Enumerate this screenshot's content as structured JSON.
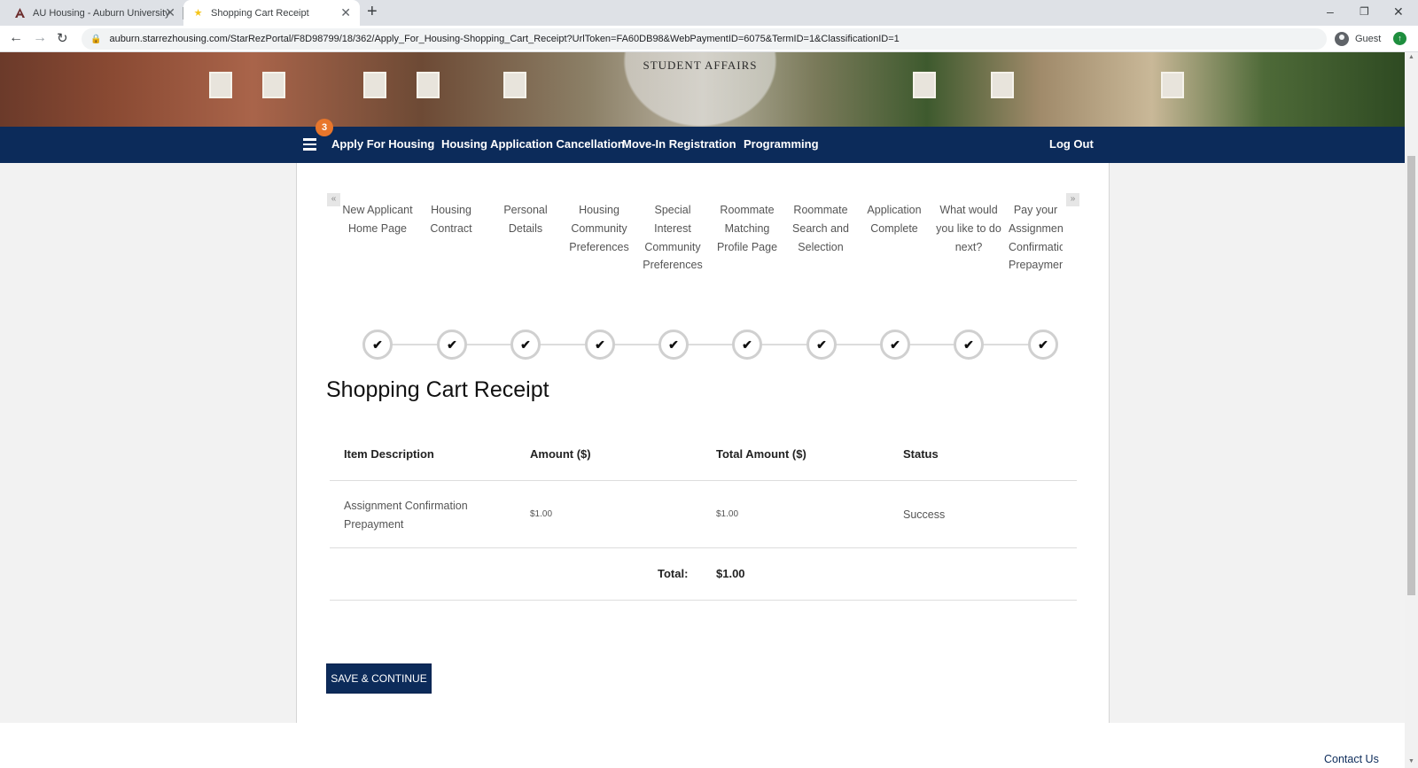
{
  "browser": {
    "tabs": [
      {
        "title": "AU Housing - Auburn University",
        "active": false
      },
      {
        "title": "Shopping Cart Receipt",
        "active": true
      }
    ],
    "url": "auburn.starrezhousing.com/StarRezPortal/F8D98799/18/362/Apply_For_Housing-Shopping_Cart_Receipt?UrlToken=FA60DB98&WebPaymentID=6075&TermID=1&ClassificationID=1",
    "profile_label": "Guest"
  },
  "hero": {
    "brand_text": "STUDENT AFFAIRS"
  },
  "nav": {
    "badge_count": "3",
    "links": [
      "Apply For Housing",
      "Housing Application Cancellation",
      "Move-In Registration",
      "Programming"
    ],
    "logout": "Log Out"
  },
  "steps": [
    {
      "label": "New Applicant Home Page",
      "complete": true
    },
    {
      "label": "Housing Contract",
      "complete": true
    },
    {
      "label": "Personal Details",
      "complete": true
    },
    {
      "label": "Housing Community Preferences",
      "complete": true
    },
    {
      "label": "Special Interest Community Preferences",
      "complete": true
    },
    {
      "label": "Roommate Matching Profile Page",
      "complete": true
    },
    {
      "label": "Roommate Search and Selection",
      "complete": true
    },
    {
      "label": "Application Complete",
      "complete": true
    },
    {
      "label": "What would you like to do next?",
      "complete": true
    },
    {
      "label": "Pay your Assignment Confirmation Prepayment",
      "complete": true
    }
  ],
  "page": {
    "title": "Shopping Cart Receipt"
  },
  "table": {
    "headers": [
      "Item Description",
      "Amount ($)",
      "Total Amount ($)",
      "Status"
    ],
    "rows": [
      {
        "item": "Assignment Confirmation Prepayment",
        "amount": "$1.00",
        "total": "$1.00",
        "status": "Success"
      }
    ],
    "total_label": "Total:",
    "total_value": "$1.00"
  },
  "actions": {
    "save_continue": "SAVE & CONTINUE"
  },
  "footer": {
    "contact_link": "Contact Us"
  },
  "colors": {
    "nav_bg": "#0c2b5a",
    "badge": "#e8762b",
    "button_bg": "#0c2b5a"
  }
}
